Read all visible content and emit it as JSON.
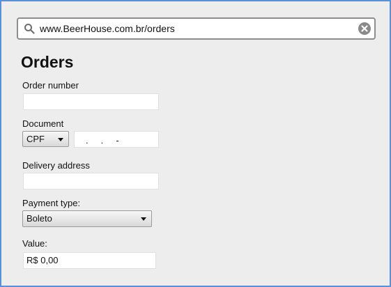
{
  "browser": {
    "url": "www.BeerHouse.com.br/orders"
  },
  "page": {
    "title": "Orders"
  },
  "form": {
    "order_number": {
      "label": "Order number",
      "value": ""
    },
    "document": {
      "label": "Document",
      "type_selected": "CPF",
      "value_mask": ".     .     -"
    },
    "delivery_address": {
      "label": "Delivery address",
      "value": ""
    },
    "payment_type": {
      "label": "Payment type:",
      "selected": "Boleto"
    },
    "value": {
      "label": "Value:",
      "value": "R$ 0,00"
    }
  },
  "icons": {
    "search": "search-icon",
    "clear": "clear-icon",
    "dropdown": "chevron-down-icon"
  },
  "colors": {
    "window_border": "#5b8fd6",
    "background": "#ededed",
    "urlbar_border": "#8d8d8d"
  }
}
